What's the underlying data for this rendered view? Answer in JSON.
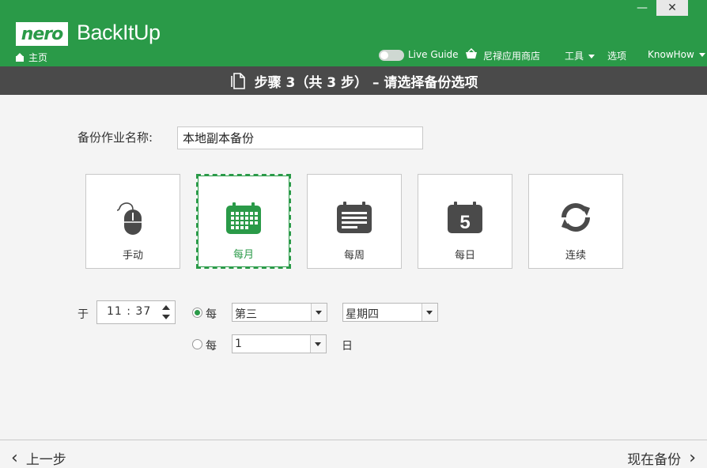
{
  "window": {
    "minimize_glyph": "—",
    "close_glyph": "✕"
  },
  "header": {
    "logo_text": "nero",
    "app_name": "BackItUp",
    "home_label": "主页",
    "live_guide_label": "Live Guide",
    "store_label": "尼禄应用商店",
    "tools_label": "工具",
    "options_label": "选项",
    "knowhow_label": "KnowHow",
    "accent_color": "#2a9a48"
  },
  "stepbar": {
    "title": "步骤 3（共 3 步） – 请选择备份选项"
  },
  "job_name": {
    "label": "备份作业名称:",
    "value": "本地副本备份"
  },
  "schedule_tiles": [
    {
      "label": "手动",
      "icon": "mouse-icon",
      "selected": false
    },
    {
      "label": "每月",
      "icon": "calendar-month-icon",
      "selected": true
    },
    {
      "label": "每周",
      "icon": "calendar-week-icon",
      "selected": false
    },
    {
      "label": "每日",
      "icon": "calendar-day-icon",
      "day_number": "5",
      "selected": false
    },
    {
      "label": "连续",
      "icon": "refresh-icon",
      "selected": false
    }
  ],
  "time": {
    "at_label": "于",
    "value": "11 : 37"
  },
  "option1": {
    "label": "每",
    "checked": true,
    "week_ordinal": "第三",
    "weekday": "星期四"
  },
  "option2": {
    "label": "每",
    "checked": false,
    "day_value": "1",
    "day_suffix": "日"
  },
  "footer": {
    "back_label": "上一步",
    "next_label": "现在备份"
  }
}
